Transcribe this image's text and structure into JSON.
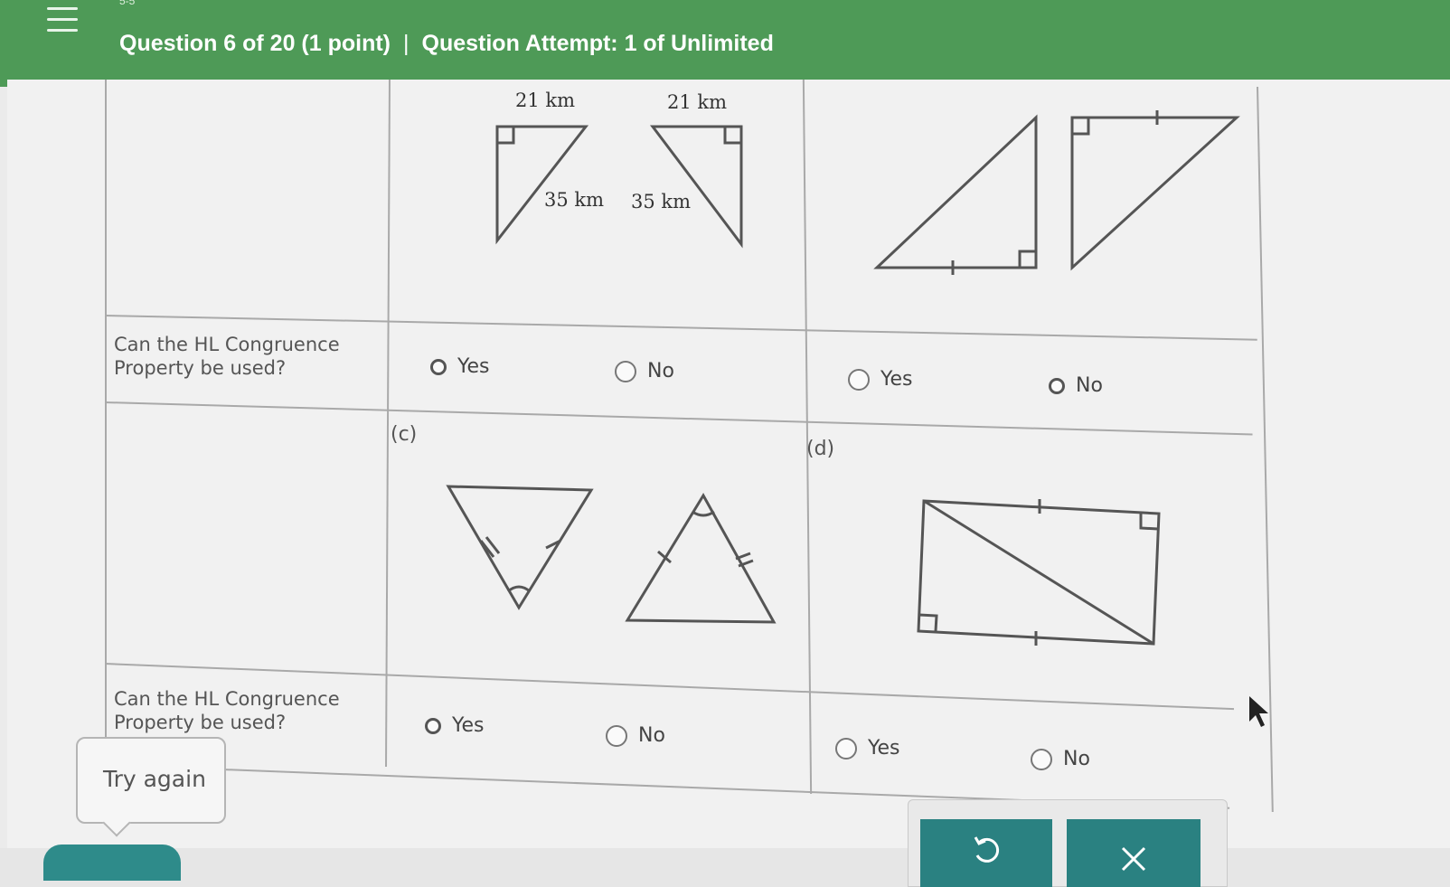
{
  "header": {
    "section_crumb": "5-5",
    "question_label": "Question 6 of 20 (1 point)",
    "separator": "|",
    "attempt_label": "Question Attempt: 1 of Unlimited",
    "bar_color": "#4e9a57"
  },
  "grid": {
    "row_label": "Can the HL Congruence Property be used?",
    "cells": [
      {
        "id": "b",
        "tag": "",
        "figure_labels": {
          "left_top": "21 km",
          "left_hyp": "35 km",
          "right_top": "21 km",
          "right_hyp": "35 km"
        },
        "options": {
          "yes": "Yes",
          "no": "No"
        }
      },
      {
        "id": "b2",
        "tag": "",
        "options": {
          "yes": "Yes",
          "no": "No"
        }
      },
      {
        "id": "c",
        "tag": "(c)",
        "options": {
          "yes": "Yes",
          "no": "No"
        }
      },
      {
        "id": "d",
        "tag": "(d)",
        "options": {
          "yes": "Yes",
          "no": "No"
        }
      }
    ]
  },
  "feedback": {
    "tooltip": "Try again"
  },
  "actions": {
    "undo_icon": "undo-icon",
    "clear_icon": "close-icon",
    "button_color": "#2a8181"
  }
}
